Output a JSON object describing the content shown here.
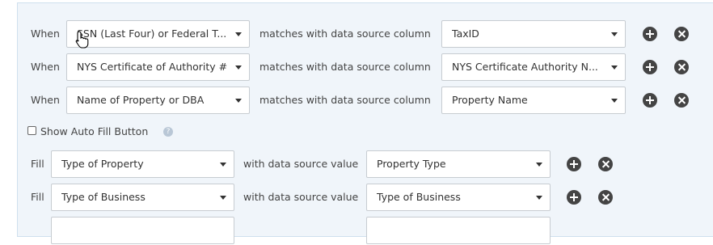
{
  "mappings": [
    {
      "when_label": "When",
      "field": "SSN (Last Four) or Federal T...",
      "connector": "matches with data source column",
      "column": "TaxID"
    },
    {
      "when_label": "When",
      "field": "NYS Certificate of Authority #",
      "connector": "matches with data source column",
      "column": "NYS Certificate Authority N..."
    },
    {
      "when_label": "When",
      "field": "Name of Property or DBA",
      "connector": "matches with data source column",
      "column": "Property Name"
    }
  ],
  "auto_fill": {
    "label": "Show Auto Fill Button",
    "checked": false,
    "help_icon": "question-circle-icon"
  },
  "fills": [
    {
      "fill_label": "Fill",
      "field": "Type of Property",
      "connector": "with data source value",
      "value": "Property Type"
    },
    {
      "fill_label": "Fill",
      "field": "Type of Business",
      "connector": "with data source value",
      "value": "Type of Business"
    },
    {
      "fill_label": "",
      "field": "",
      "connector": "",
      "value": ""
    }
  ],
  "icons": {
    "add": "plus-circle-icon",
    "remove": "times-circle-icon"
  }
}
